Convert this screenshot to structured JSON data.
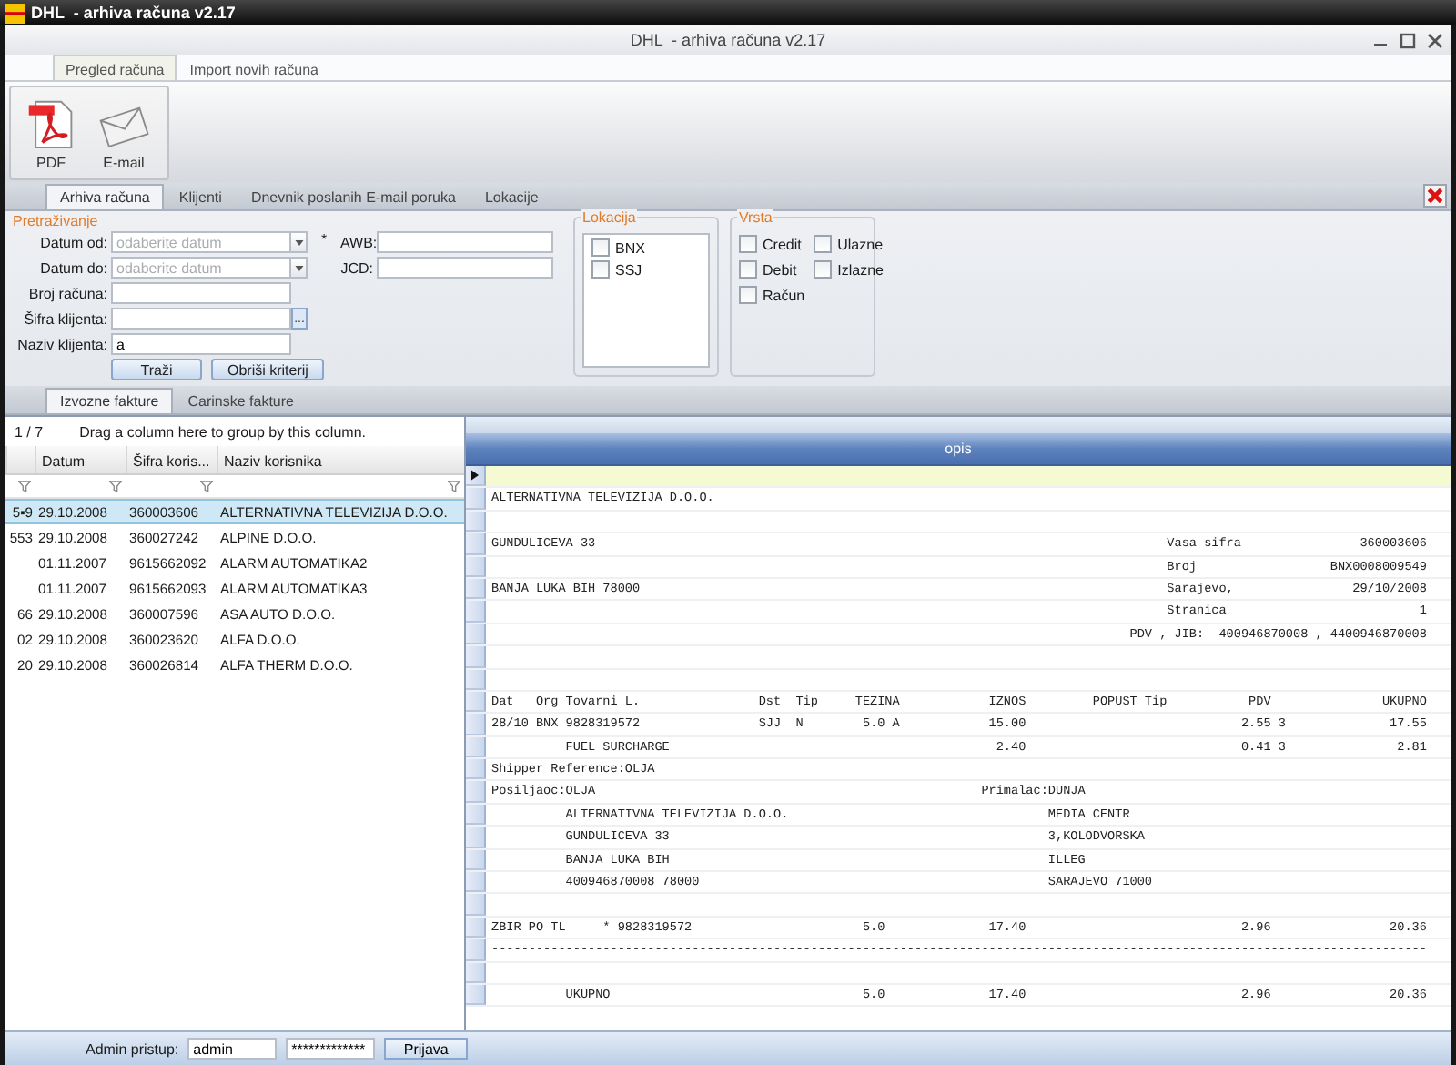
{
  "window": {
    "title": "DHL  - arhiva računa v2.17",
    "caption": "DHL  - arhiva računa v2.17"
  },
  "ribbon": {
    "tabs": [
      {
        "label": "Pregled računa",
        "selected": true
      },
      {
        "label": "Import novih računa",
        "selected": false
      }
    ],
    "buttons": [
      {
        "kind": "pdf",
        "label": "PDF"
      },
      {
        "kind": "email",
        "label": "E-mail"
      }
    ]
  },
  "main_tabs": [
    {
      "label": "Arhiva računa",
      "selected": true
    },
    {
      "label": "Klijenti",
      "selected": false
    },
    {
      "label": "Dnevnik poslanih E-mail poruka",
      "selected": false
    },
    {
      "label": "Lokacije",
      "selected": false
    }
  ],
  "search": {
    "title": "Pretraživanje",
    "fields": [
      {
        "kind": "date",
        "label": "Datum od:",
        "placeholder": "odaberite datum"
      },
      {
        "kind": "date",
        "label": "Datum do:",
        "placeholder": "odaberite datum"
      },
      {
        "kind": "text",
        "label": "Broj računa:"
      },
      {
        "kind": "lookup",
        "label": "Šifra klijenta:",
        "button": "..."
      },
      {
        "kind": "text",
        "label": "Naziv klijenta:",
        "value": "a"
      }
    ],
    "required_mark": "*",
    "side_fields": [
      {
        "label": "AWB:"
      },
      {
        "label": "JCD:"
      }
    ],
    "buttons": [
      "Traži",
      "Obriši kriterij"
    ]
  },
  "lokacija": {
    "title": "Lokacija",
    "items": [
      {
        "label": "BNX",
        "checked": false
      },
      {
        "label": "SSJ",
        "checked": false
      }
    ]
  },
  "vrsta": {
    "title": "Vrsta",
    "items": [
      {
        "label": "Credit",
        "checked": false
      },
      {
        "label": "Ulazne",
        "checked": false
      },
      {
        "label": "Debit",
        "checked": false
      },
      {
        "label": "Izlazne",
        "checked": false
      },
      {
        "label": "Račun",
        "checked": false
      }
    ]
  },
  "sub_tabs": [
    {
      "label": "Izvozne fakture",
      "selected": true
    },
    {
      "label": "Carinske fakture",
      "selected": false
    }
  ],
  "grid": {
    "counter": "1 / 7",
    "group_hint": "Drag a column here to group by this column.",
    "columns": [
      "Datum",
      "Šifra koris...",
      "Naziv korisnika"
    ],
    "rows": [
      {
        "column_1": "5▪9",
        "datum": "29.10.2008",
        "sifra": "360003606",
        "naziv": "ALTERNATIVNA TELEVIZIJA D.O.O.",
        "selected": true
      },
      {
        "column_1": "553",
        "datum": "29.10.2008",
        "sifra": "360027242",
        "naziv": "ALPINE D.O.O.",
        "selected": false
      },
      {
        "datum": "01.11.2007",
        "sifra": "9615662092",
        "naziv": "ALARM AUTOMATIKA2",
        "selected": false
      },
      {
        "datum": "01.11.2007",
        "sifra": "9615662093",
        "naziv": "ALARM AUTOMATIKA3",
        "selected": false
      },
      {
        "column_1": "66",
        "datum": "29.10.2008",
        "sifra": "360007596",
        "naziv": "ASA AUTO D.O.O.",
        "selected": false
      },
      {
        "column_1": "02",
        "datum": "29.10.2008",
        "sifra": "360023620",
        "naziv": "ALFA D.O.O.",
        "selected": false
      },
      {
        "column_1": "20",
        "datum": "29.10.2008",
        "sifra": "360026814",
        "naziv": "ALFA THERM D.O.O.",
        "selected": false
      }
    ]
  },
  "report": {
    "header": "opis",
    "rows": [
      {
        "selected": true
      },
      {
        "text": "ALTERNATIVNA TELEVIZIJA D.O.O.",
        "selected": false
      },
      {
        "selected": false
      },
      {
        "text": "GUNDULICEVA 33                                                                             Vasa sifra                360003606",
        "selected": false
      },
      {
        "text": "                                                                                           Broj                  BNX0008009549",
        "selected": false
      },
      {
        "text": "BANJA LUKA BIH 78000                                                                       Sarajevo,                29/10/2008",
        "selected": false
      },
      {
        "text": "                                                                                           Stranica                          1",
        "selected": false
      },
      {
        "text": "                                                                                      PDV , JIB:  400946870008 , 4400946870008",
        "selected": false
      },
      {
        "selected": false
      },
      {
        "selected": false
      },
      {
        "text": "Dat   Org Tovarni L.                Dst  Tip     TEZINA            IZNOS         POPUST Tip           PDV               UKUPNO",
        "selected": false
      },
      {
        "text": "28/10 BNX 9828319572                SJJ  N        5.0 A            15.00                             2.55 3              17.55",
        "selected": false
      },
      {
        "text": "          FUEL SURCHARGE                                            2.40                             0.41 3               2.81",
        "selected": false
      },
      {
        "text": "Shipper Reference:OLJA",
        "selected": false
      },
      {
        "text": "Posiljaoc:OLJA                                                    Primalac:DUNJA",
        "selected": false
      },
      {
        "text": "          ALTERNATIVNA TELEVIZIJA D.O.O.                                   MEDIA CENTR",
        "selected": false
      },
      {
        "text": "          GUNDULICEVA 33                                                   3,KOLODVORSKA",
        "selected": false
      },
      {
        "text": "          BANJA LUKA BIH                                                   ILLEG",
        "selected": false
      },
      {
        "text": "          400946870008 78000                                               SARAJEVO 71000",
        "selected": false
      },
      {
        "selected": false
      },
      {
        "text": "ZBIR PO TL     * 9828319572                       5.0              17.40                             2.96                20.36",
        "selected": false
      },
      {
        "text": "------------------------------------------------------------------------------------------------------------------------------",
        "selected": false
      },
      {
        "selected": false
      },
      {
        "text": "          UKUPNO                                  5.0              17.40                             2.96                20.36",
        "selected": false
      }
    ]
  },
  "login": {
    "label": "Admin pristup:",
    "username": "admin",
    "password": "*************",
    "button": "Prijava"
  }
}
